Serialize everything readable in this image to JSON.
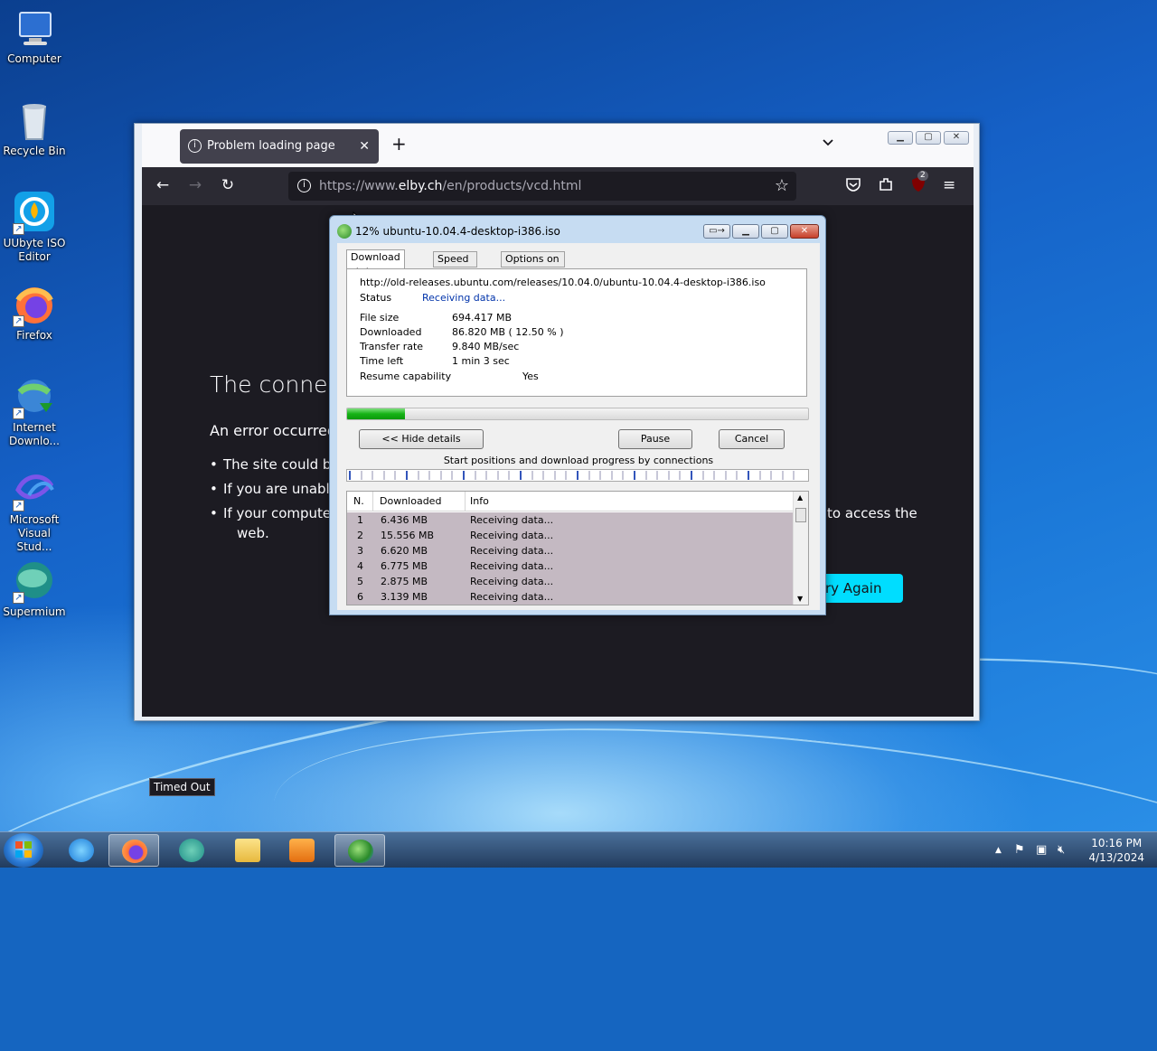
{
  "desktop": {
    "icons": [
      {
        "name": "computer",
        "label": "Computer"
      },
      {
        "name": "recycle-bin",
        "label": "Recycle Bin"
      },
      {
        "name": "uubyte",
        "label": "UUbyte ISO Editor"
      },
      {
        "name": "firefox",
        "label": "Firefox"
      },
      {
        "name": "idm",
        "label": "Internet Downlo..."
      },
      {
        "name": "visual-studio",
        "label": "Microsoft Visual Stud..."
      },
      {
        "name": "supermium",
        "label": "Supermium"
      }
    ]
  },
  "browser": {
    "tab_title": "Problem loading page",
    "url_prefix": "https://www.",
    "url_domain": "elby.ch",
    "url_path": "/en/products/vcd.html",
    "extension_badge": "2",
    "error_title": "The connect",
    "error_sub": "An error occurred",
    "bullets": [
      "The site could b",
      "If you are unabl",
      "If your compute"
    ],
    "bullet3_tail": "to access the",
    "bullet3_line2": "web.",
    "try_again": "ry Again",
    "status": "Timed Out"
  },
  "idm": {
    "title": "12% ubuntu-10.04.4-desktop-i386.iso",
    "tabs": [
      "Download status",
      "Speed Limiter",
      "Options on completion"
    ],
    "url": "http://old-releases.ubuntu.com/releases/10.04.0/ubuntu-10.04.4-desktop-i386.iso",
    "status_label": "Status",
    "status_value": "Receiving data...",
    "file_size_label": "File size",
    "file_size": "694.417  MB",
    "downloaded_label": "Downloaded",
    "downloaded": "86.820  MB  ( 12.50 % )",
    "rate_label": "Transfer rate",
    "rate": "9.840  MB/sec",
    "time_left_label": "Time left",
    "time_left": "1 min 3 sec",
    "resume_label": "Resume capability",
    "resume": "Yes",
    "progress_fraction": 0.125,
    "hide_details": "<< Hide details",
    "pause": "Pause",
    "cancel": "Cancel",
    "connections_caption": "Start positions and download progress by connections",
    "columns": [
      "N.",
      "Downloaded",
      "Info"
    ],
    "connections": [
      {
        "n": "1",
        "downloaded": "6.436  MB",
        "info": "Receiving data..."
      },
      {
        "n": "2",
        "downloaded": "15.556  MB",
        "info": "Receiving data..."
      },
      {
        "n": "3",
        "downloaded": "6.620  MB",
        "info": "Receiving data..."
      },
      {
        "n": "4",
        "downloaded": "6.775  MB",
        "info": "Receiving data..."
      },
      {
        "n": "5",
        "downloaded": "2.875  MB",
        "info": "Receiving data..."
      },
      {
        "n": "6",
        "downloaded": "3.139  MB",
        "info": "Receiving data..."
      }
    ]
  },
  "taskbar": {
    "time": "10:16 PM",
    "date": "4/13/2024"
  },
  "colors": {
    "accent_try_again": "#00ddff",
    "progress_green": "#16b316",
    "row_highlight": "#c4b9c2"
  }
}
